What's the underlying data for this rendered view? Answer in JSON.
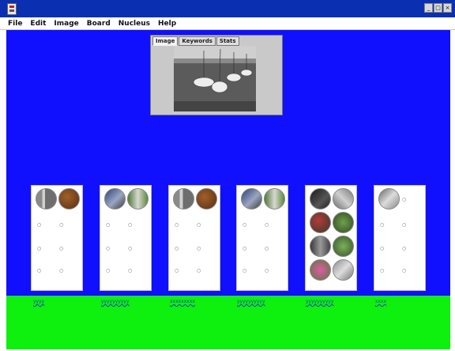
{
  "window": {
    "minimize_glyph": "_",
    "maximize_glyph": "□",
    "close_glyph": "×"
  },
  "menu": {
    "items": [
      "File",
      "Edit",
      "Image",
      "Board",
      "Nucleus",
      "Help"
    ]
  },
  "preview": {
    "tabs": [
      "Image",
      "Keywords",
      "Stats"
    ],
    "active_tab": "Image"
  },
  "colors": {
    "workspace": "#1010ff",
    "footer": "#0ef00e",
    "titlebar": "#0a2fb0"
  },
  "groups": [
    {
      "label": "yyyy",
      "thumbs": [
        "street-scene",
        "brown-texture"
      ],
      "dots": 6
    },
    {
      "label": "yyyyyyyyyy",
      "thumbs": [
        "blue-scene",
        "green-scene"
      ],
      "dots": 6
    },
    {
      "label": "xxxxxxxxx",
      "thumbs": [
        "street-scene",
        "brown-texture"
      ],
      "dots": 6
    },
    {
      "label": "yyyyyyyyyy",
      "thumbs": [
        "blue-scene",
        "green-scene"
      ],
      "dots": 6
    },
    {
      "label": "yyyyyyyyyy",
      "thumbs": [
        "dark-scene",
        "gray-scene",
        "red-scene",
        "green-scene",
        "gray-scene",
        "green-scene",
        "pink-scene",
        "gray-scene"
      ],
      "dots": 0
    },
    {
      "label": "xxxx",
      "thumbs": [
        "gray-scene"
      ],
      "dots": 7
    }
  ]
}
